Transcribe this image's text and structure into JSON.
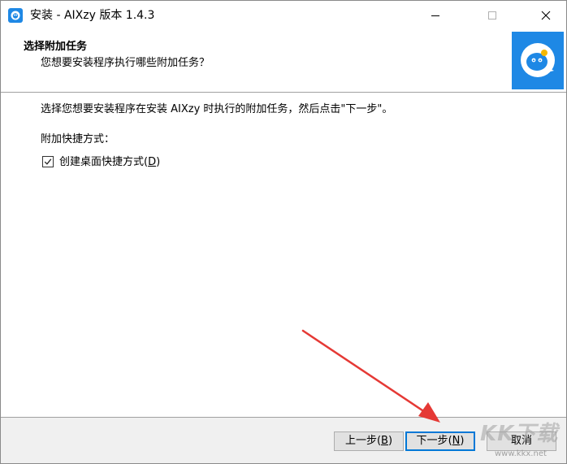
{
  "window": {
    "title": "安装 - AIXzy 版本 1.4.3",
    "controls": {
      "minimize": "minimize",
      "maximize": "maximize",
      "close": "close"
    }
  },
  "header": {
    "title": "选择附加任务",
    "subtitle": "您想要安装程序执行哪些附加任务？",
    "logo_icon": "aixzy-logo-icon"
  },
  "body": {
    "description": "选择您想要安装程序在安装 AIXzy 时执行的附加任务，然后点击\"下一步\"。",
    "section_label": "附加快捷方式：",
    "checkbox": {
      "label": "创建桌面快捷方式",
      "mnemonic_open": "(",
      "mnemonic_key": "D",
      "mnemonic_close": ")",
      "checked": true
    }
  },
  "buttons": {
    "back": {
      "label": "上一步",
      "open": "(",
      "key": "B",
      "close": ")"
    },
    "next": {
      "label": "下一步",
      "open": "(",
      "key": "N",
      "close": ")"
    },
    "cancel": {
      "label": "取消"
    }
  },
  "watermark": {
    "main": "KK下载",
    "sub": "www.kkx.net"
  },
  "colors": {
    "accent": "#1e88e5",
    "arrow": "#e53935",
    "button_focus": "#0078d7",
    "bottom_bar": "#f0f0f0"
  }
}
